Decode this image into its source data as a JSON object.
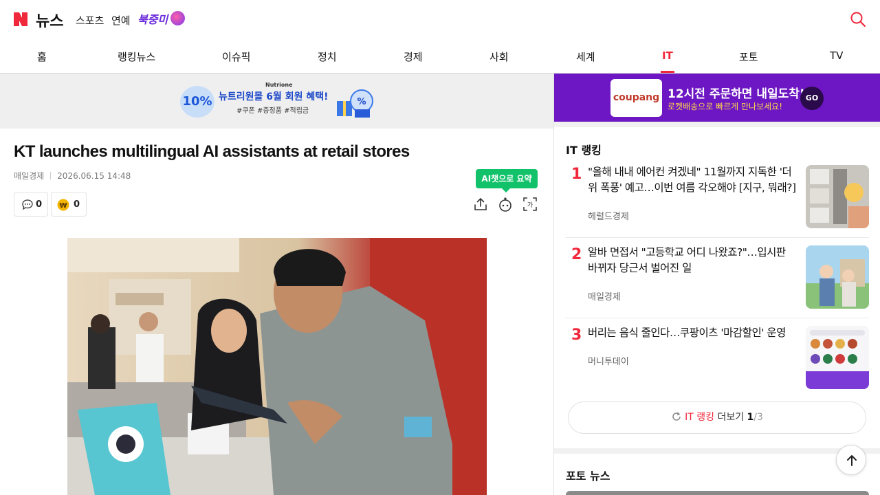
{
  "header": {
    "logo_text": "뉴스",
    "links": [
      "스포츠",
      "연예"
    ],
    "promo_label": "북중미"
  },
  "nav": {
    "items": [
      "홈",
      "랭킹뉴스",
      "이슈픽",
      "정치",
      "경제",
      "사회",
      "세계",
      "IT",
      "포토",
      "TV"
    ],
    "active": "IT"
  },
  "ad_top": {
    "brand": "Nutrione",
    "badge": "10%",
    "title": "뉴트리원몰 6월 회원 혜택!",
    "subtitle": "#쿠폰 #증정품 #적립금"
  },
  "article": {
    "headline": "KT launches multilingual AI assistants at retail stores",
    "source": "매일경제",
    "datetime": "2026.06.15 14:48",
    "comment_count": "0",
    "reaction_count": "0",
    "ai_summary_label": "AI챗으로 요약"
  },
  "ad_side": {
    "logo": "coupang",
    "title": "12시전 주문하면 내일도착!",
    "subtitle": "로켓배송으로 빠르게 만나보세요!",
    "go": "GO"
  },
  "ranking": {
    "title": "IT 랭킹",
    "items": [
      {
        "rank": "1",
        "title": "\"올해 내내 에어컨 켜겠네\" 11월까지 지독한 '더위 폭풍' 예고…이번 여름 각오해야 [지구, 뭐래?]",
        "source": "헤럴드경제"
      },
      {
        "rank": "2",
        "title": "알바 면접서 \"고등학교 어디 나왔죠?\"…입시판 바뀌자 당근서 벌어진 일",
        "source": "매일경제"
      },
      {
        "rank": "3",
        "title": "버리는 음식 줄인다…쿠팡이츠 '마감할인' 운영",
        "source": "머니투데이"
      }
    ],
    "more_highlight": "IT 랭킹",
    "more_label": "더보기",
    "page": "1",
    "total": "/3"
  },
  "photo_news": {
    "title": "포토 뉴스"
  },
  "colors": {
    "accent": "#f0283c",
    "naver_green": "#12c26b",
    "coupang_purple": "#6d16c3"
  }
}
